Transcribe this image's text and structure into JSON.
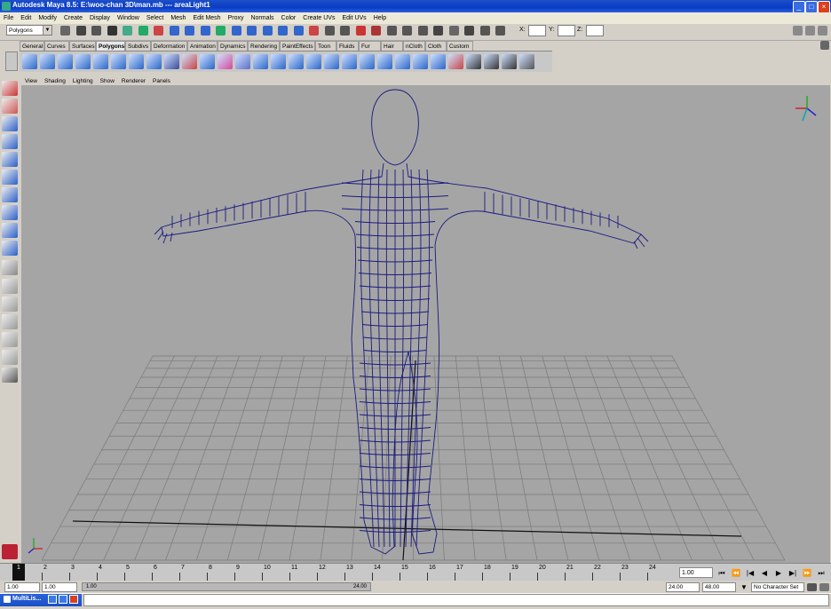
{
  "window": {
    "title": "Autodesk Maya 8.5: E:\\woo-chan 3D\\man.mb  ---  areaLight1"
  },
  "menubar": {
    "items": [
      "File",
      "Edit",
      "Modify",
      "Create",
      "Display",
      "Window",
      "Select",
      "Mesh",
      "Edit Mesh",
      "Proxy",
      "Normals",
      "Color",
      "Create UVs",
      "Edit UVs",
      "Help"
    ]
  },
  "statusline": {
    "mode_selector": "Polygons",
    "x_label": "X:",
    "y_label": "Y:",
    "z_label": "Z:"
  },
  "shelf": {
    "tabs": [
      "General",
      "Curves",
      "Surfaces",
      "Polygons",
      "Subdivs",
      "Deformation",
      "Animation",
      "Dynamics",
      "Rendering",
      "PaintEffects",
      "Toon",
      "Fluids",
      "Fur",
      "Hair",
      "nCloth",
      "Cloth",
      "Custom"
    ],
    "active_tab": "Polygons"
  },
  "panel_menu": {
    "items": [
      "View",
      "Shading",
      "Lighting",
      "Show",
      "Renderer",
      "Panels"
    ]
  },
  "viewport": {
    "background_color": "#a5a5a5",
    "wire_color": "#1a1a80",
    "grid_color": "#7a7a7a"
  },
  "timeslider": {
    "tick_labels": [
      "1",
      "2",
      "3",
      "4",
      "5",
      "6",
      "7",
      "8",
      "9",
      "10",
      "11",
      "12",
      "13",
      "14",
      "15",
      "16",
      "17",
      "18",
      "19",
      "20",
      "21",
      "22",
      "23",
      "24"
    ],
    "current_frame_marker": "1",
    "current_frame_value": "1.00"
  },
  "rangeslider": {
    "start_time": "1.00",
    "playback_start": "1.00",
    "range_left_label": "1.00",
    "range_right_label": "24.00",
    "playback_end": "24.00",
    "end_time": "48.00",
    "character_set": "No Character Set"
  },
  "taskbar": {
    "command_tab_label": "MultiLis..."
  }
}
